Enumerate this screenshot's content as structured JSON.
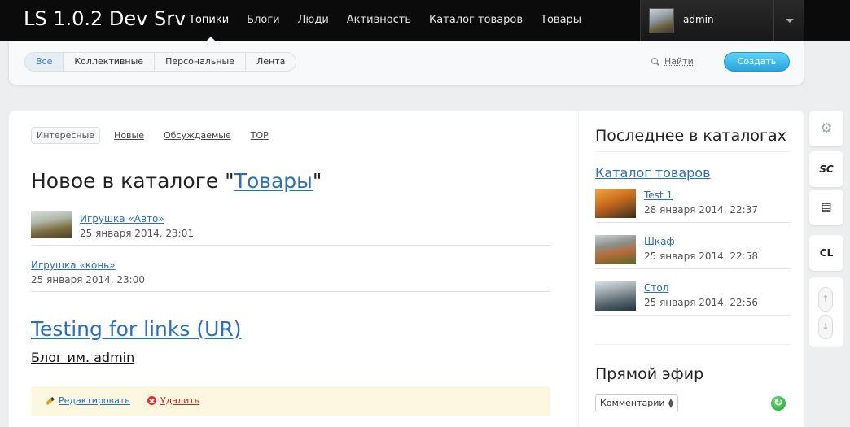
{
  "header": {
    "site_title": "LS 1.0.2 Dev Srv",
    "nav": [
      "Топики",
      "Блоги",
      "Люди",
      "Активность",
      "Каталог товаров",
      "Товары"
    ],
    "active_nav": "Топики",
    "username": "admin"
  },
  "filterbar": {
    "tabs": [
      "Все",
      "Коллективные",
      "Персональные",
      "Лента"
    ],
    "active_tab": "Все",
    "search_label": "Найти",
    "create_label": "Создать"
  },
  "main": {
    "subtabs": [
      "Интересные",
      "Новые",
      "Обсуждаемые",
      "TOP"
    ],
    "active_subtab": "Интересные",
    "catalog_heading": {
      "prefix": "Новое в каталоге \"",
      "link": "Товары",
      "suffix": "\""
    },
    "catalog_items": [
      {
        "title": "Игрушка «Авто»",
        "date": "25 января 2014, 23:01",
        "has_thumb": true
      },
      {
        "title": "Игрушка «конь»",
        "date": "25 января 2014, 23:00",
        "has_thumb": false
      }
    ],
    "post": {
      "title": "Testing for links (UR)",
      "blog": "Блог им. admin",
      "edit_label": "Редактировать",
      "delete_label": "Удалить"
    }
  },
  "sidebar": {
    "latest_heading": "Последнее в каталогах",
    "catalog_link": "Каталог товаров",
    "items": [
      {
        "title": "Test 1",
        "date": "28 января 2014, 22:37"
      },
      {
        "title": "Шкаф",
        "date": "25 января 2014, 22:58"
      },
      {
        "title": "Стол",
        "date": "25 января 2014, 22:56"
      }
    ],
    "live_heading": "Прямой эфир",
    "live_select": "Комментарии"
  },
  "toolbar": {
    "items": [
      "gear-icon",
      "SC",
      "list-icon",
      "CL"
    ],
    "up_label": "↑",
    "down_label": "↓"
  },
  "colors": {
    "topbar": "#0b0b0b",
    "link": "#2a6ebd",
    "create_button": "#27a5e0",
    "action_bar": "#fcf8e0"
  }
}
